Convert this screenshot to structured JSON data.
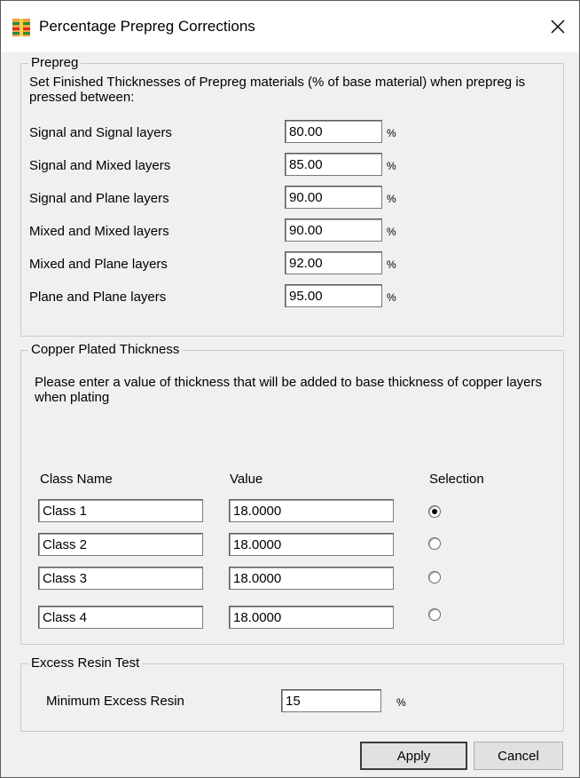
{
  "window": {
    "title": "Percentage Prepreg Corrections",
    "icon": "prepreg-stack-icon",
    "close_symbol": "✕"
  },
  "prepreg": {
    "legend": "Prepreg",
    "description": "Set Finished Thicknesses of Prepreg materials  (% of base material) when prepreg is pressed between:",
    "percent_symbol": "%",
    "rows": [
      {
        "label": "Signal and Signal layers",
        "value": "80.00"
      },
      {
        "label": "Signal and Mixed layers",
        "value": "85.00"
      },
      {
        "label": "Signal and Plane layers",
        "value": "90.00"
      },
      {
        "label": "Mixed and Mixed layers",
        "value": "90.00"
      },
      {
        "label": "Mixed and Plane layers",
        "value": "92.00"
      },
      {
        "label": "Plane and Plane layers",
        "value": "95.00"
      }
    ]
  },
  "copper": {
    "legend": "Copper Plated Thickness",
    "description": "Please enter a value of thickness that will be added to base thickness of copper layers when plating",
    "headers": {
      "class_name": "Class Name",
      "value": "Value",
      "selection": "Selection"
    },
    "rows": [
      {
        "class_name": "Class 1",
        "value": "18.0000",
        "selected": true
      },
      {
        "class_name": "Class 2",
        "value": "18.0000",
        "selected": false
      },
      {
        "class_name": "Class 3",
        "value": "18.0000",
        "selected": false
      },
      {
        "class_name": "Class 4",
        "value": "18.0000",
        "selected": false
      }
    ]
  },
  "excess_resin": {
    "legend": "Excess Resin Test",
    "label": "Minimum Excess Resin",
    "value": "15",
    "percent_symbol": "%"
  },
  "buttons": {
    "apply": "Apply",
    "cancel": "Cancel"
  }
}
